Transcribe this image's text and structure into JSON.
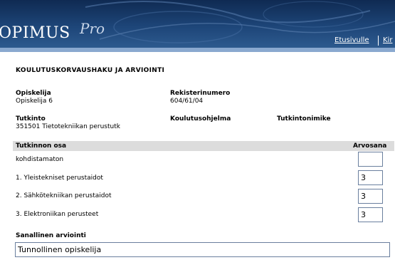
{
  "app": {
    "logo": "OPIMUS",
    "logo_suffix": "Pro"
  },
  "nav": {
    "links": [
      "Etusivulle",
      "Kir"
    ]
  },
  "page": {
    "title": "KOULUTUSKORVAUSHAKU JA ARVIOINTI"
  },
  "student": {
    "label": "Opiskelija",
    "value": "Opiskelija  6",
    "reg_label": "Rekisterinumero",
    "reg_value": "604/61/04"
  },
  "degree": {
    "label": "Tutkinto",
    "value": "351501 Tietotekniikan perustutk",
    "program_label": "Koulutusohjelma",
    "title_label": "Tutkintonimike"
  },
  "table": {
    "col_part": "Tutkinnon osa",
    "col_grade": "Arvosana",
    "rows": [
      {
        "name": "kohdistamaton",
        "grade": ""
      },
      {
        "name": "1. Yleistekniset perustaidot",
        "grade": "3"
      },
      {
        "name": "2. Sähkötekniikan perustaidot",
        "grade": "3"
      },
      {
        "name": "3. Elektroniikan perusteet",
        "grade": "3"
      }
    ]
  },
  "verbal": {
    "label": "Sanallinen arviointi",
    "value": "Tunnollinen opiskelija"
  }
}
